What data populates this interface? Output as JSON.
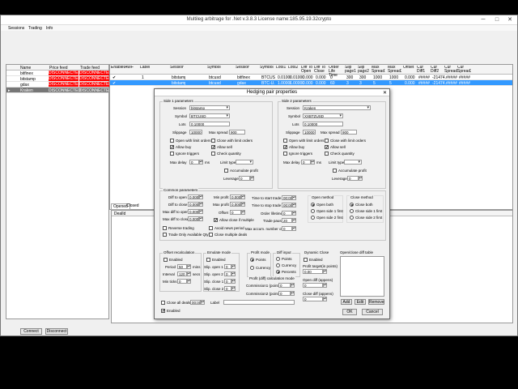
{
  "window": {
    "title": "Multileg arbitrage for .Net  v.3.8.3 License name:185.95.19.32crypto",
    "minimize": "─",
    "maximize": "□",
    "close": "✕"
  },
  "menu": [
    "Sessions",
    "Trading",
    "Info"
  ],
  "sessions": {
    "headers": [
      "Name",
      "Price feed",
      "Trade feed"
    ],
    "rows": [
      {
        "name": "bitfinex",
        "price": "DISCONNECTED",
        "trade": "DISCONNECTED"
      },
      {
        "name": "bitstamp",
        "price": "DISCONNECTED",
        "trade": "DISCONNECTED"
      },
      {
        "name": "gdax",
        "price": "DISCONNECTED",
        "trade": "DISCONNECTED"
      },
      {
        "name": "Kraken",
        "price": "DISCONNECTED",
        "trade": "DISCONNECTED"
      }
    ],
    "connect": "Connect",
    "disconnect": "Disconnect"
  },
  "grid": {
    "headers": [
      "Enabled",
      "AWF",
      "Label",
      "Session1",
      "Symbol1",
      "Session2",
      "Symbol2",
      "Lots1",
      "Lots2",
      "Diff To Open",
      "Diff To Close",
      "Order Life Time",
      "Slip page1",
      "Slip page2",
      "Max Spread1",
      "Max Spread2",
      "Offset",
      "Cur Diff1",
      "Cur Diff2",
      "Cur Spread1",
      "Cur Spread2"
    ],
    "rows": [
      [
        "✔",
        "",
        "1",
        "bitstamp",
        "btcusd",
        "bitfinex",
        "BTCUSD",
        "0.01000",
        "0.01000",
        "0.000",
        "0.000",
        "0",
        "300",
        "300",
        "1000",
        "1000",
        "0.000",
        "#####",
        "-21474...",
        "#####",
        "#####"
      ],
      [
        "✔",
        "",
        "",
        "bitstamp",
        "btcusd",
        "gdax",
        "BTC-U...",
        "1.00000",
        "1.00000",
        "0.000",
        "0.000",
        "60",
        "3",
        "3",
        "5",
        "5",
        "0.000",
        "#####",
        "-21474...",
        "#####",
        "#####"
      ]
    ]
  },
  "tabs": [
    "Opened",
    "Closed"
  ],
  "deals_header": "DealId",
  "dialog": {
    "title": "Hedging pair properties",
    "close": "✕",
    "side1": {
      "group": "Side 1 parameters",
      "session_label": "Session",
      "session": "bitstamp",
      "symbol_label": "Symbol",
      "symbol": "BTCUSD",
      "lots_label": "Lots",
      "lots": "0.10000",
      "slippage_label": "Slippage",
      "slippage": "10000",
      "maxspread_label": "Max spread",
      "maxspread": "900",
      "open_limit": "Open with limit orders",
      "close_limit": "Close with limit orders",
      "allow_buy": "Allow buy",
      "allow_sell": "Allow sell",
      "ignore_triggers": "Ignore triggers",
      "check_qty": "Check quantity",
      "max_delay_label": "Max delay",
      "max_delay": "0",
      "ms": "ms",
      "limit_type": "Limit type",
      "accum_profit": "Accumulate profit",
      "leverage_label": "Leverage",
      "leverage": "0"
    },
    "side2": {
      "group": "Side 2 parameters",
      "session_label": "Session",
      "session": "Kraken",
      "symbol_label": "Symbol",
      "symbol": "XXBTZUSD",
      "lots_label": "Lots",
      "lots": "0.10000",
      "slippage_label": "Slippage",
      "slippage": "10000",
      "maxspread_label": "Max spread",
      "maxspread": "900",
      "open_limit": "Open with limit orders",
      "close_limit": "Close with limit orders",
      "allow_buy": "Allow buy",
      "allow_sell": "Allow sell",
      "ignore_triggers": "Ignore triggers",
      "check_qty": "Check quantity",
      "max_delay_label": "Max delay",
      "max_delay": "0",
      "ms": "ms",
      "limit_type": "Limit type",
      "accum_profit": "Accumulate profit",
      "leverage_label": "Leverage",
      "leverage": "0"
    },
    "common": {
      "group": "Common parameters",
      "diff_open_label": "Diff to open",
      "diff_open": "0.000",
      "diff_close_label": "Diff to close",
      "diff_close": "0.000",
      "max_diff_open_label": "Max diff to open",
      "max_diff_open": "0.000",
      "max_diff_close_label": "Max diff to close",
      "max_diff_close": "0.000",
      "min_profit_label": "Min profit",
      "min_profit": "0.000",
      "max_profit_label": "Max profit",
      "max_profit": "0.000",
      "offset_label": "Offset",
      "offset": "0",
      "allow_multiple": "Allow close if multiple",
      "start_label": "Time to start trade",
      "start": "00:00",
      "stop_label": "Time to stop trade",
      "stop": "00:00",
      "lifetime_label": "Order lifetime",
      "lifetime": "0",
      "pause_label": "Trade pause",
      "pause": "20",
      "max_deals_label": "Max accum. number of deals",
      "max_deals": "0",
      "reverse": "Reverse trading",
      "avoid_news": "Avoid news period",
      "trade_only": "Trade Only Available Qty",
      "close_multiple": "Close multiple deals",
      "open_method": "Open method",
      "open_both": "Open both",
      "open_side1": "Open side 1 first",
      "open_side2": "Open side 2 first",
      "close_method": "Close method",
      "close_both": "Close both",
      "close_side1": "Close side 1 first",
      "close_side2": "Close side 2 first"
    },
    "offset_recalc": {
      "group": "Offset recalculation",
      "enabled": "Enabled",
      "period_label": "Period",
      "period": "50",
      "mins": "mins",
      "interval_label": "Interval",
      "interval": "120",
      "secs": "secs",
      "min_ticks_label": "Min ticks",
      "min_ticks": "0"
    },
    "emulate": {
      "group": "Emulate mode",
      "enabled": "Enabled",
      "slip_open1": "Slip. open 1",
      "slip_open2": "Slip. open 2",
      "slip_close1": "Slip. close 1",
      "slip_close2": "Slip. close 2",
      "v1": "0",
      "v2": "0",
      "v3": "0",
      "v4": "0"
    },
    "profit_mode": {
      "group": "Profit mode",
      "points": "Points",
      "currency": "Currency"
    },
    "diff_input": {
      "group": "Diff input",
      "points": "Points",
      "currency": "Currency",
      "percents": "Percents"
    },
    "profit_calc": {
      "group": "Profit (diff) calculation mode",
      "comm1_label": "Commission1 (points)",
      "comm1": "0",
      "comm2_label": "Commission2 (points)",
      "comm2": "0"
    },
    "dynamic": {
      "group": "Dynamic Close",
      "enabled": "Enabled",
      "target_label": "Profit target(in points)",
      "target": "0.00",
      "open_diff_label": "Open diff (appens)",
      "open_diff": "0",
      "close_diff_label": "Close diff (appens)",
      "close_diff": "0"
    },
    "oc_table": {
      "label": "Open/close diff table",
      "add": "Add",
      "edit": "Edit",
      "remove": "Remove"
    },
    "close_all": "Close all deals at",
    "close_all_time": "00:00",
    "label_label": "Label",
    "enabled": "Enabled",
    "ok": "OK",
    "cancel": "Cancel"
  }
}
